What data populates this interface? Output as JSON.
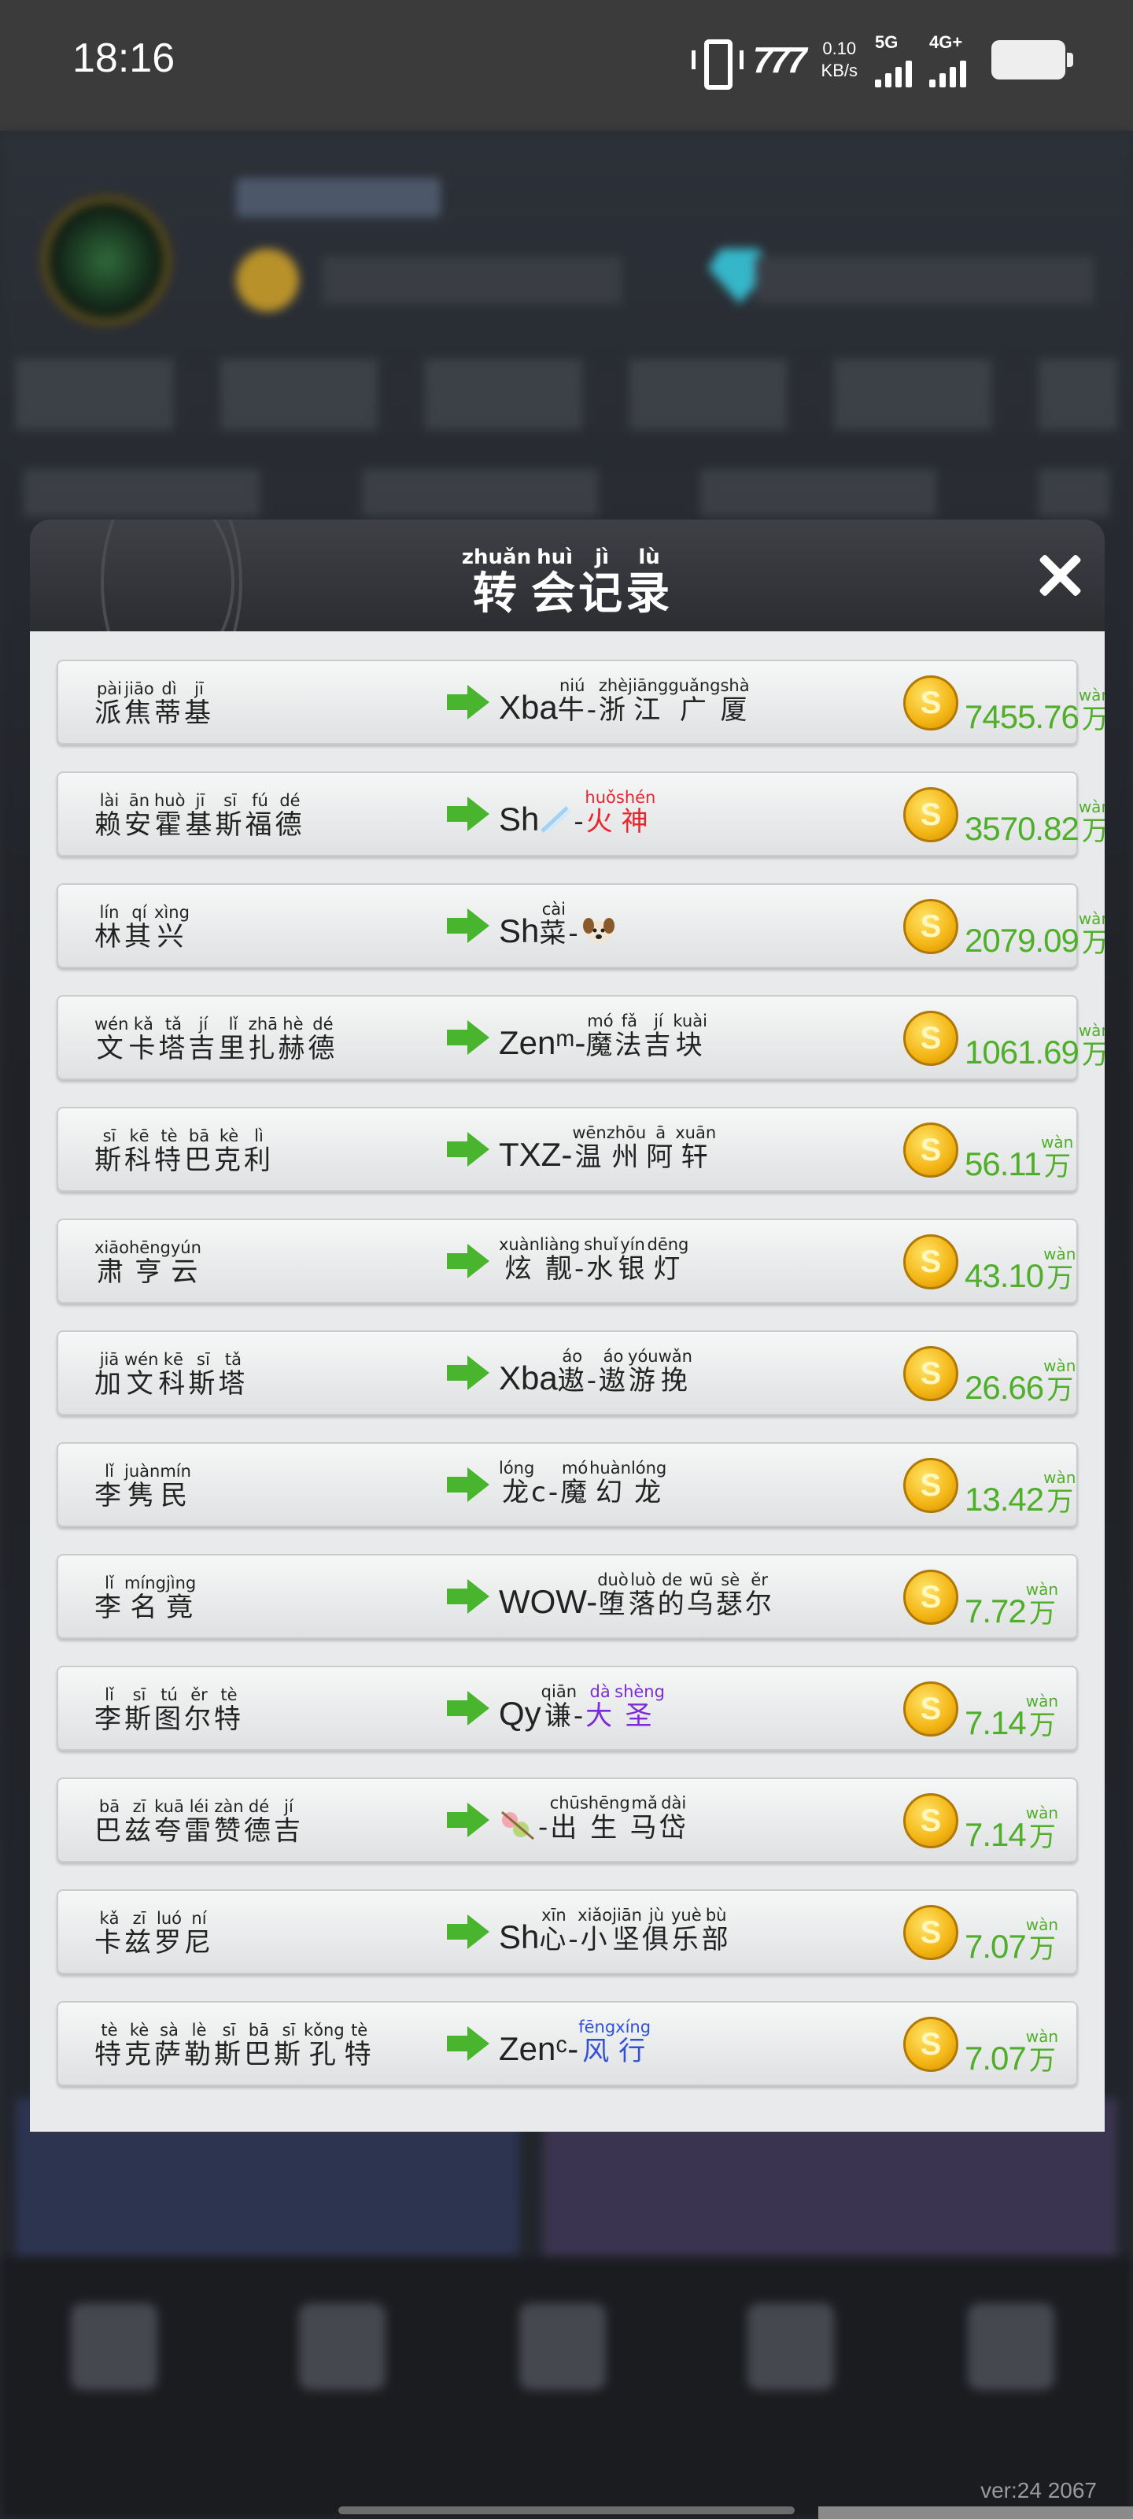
{
  "status_bar": {
    "time": "18:16",
    "logo": "777",
    "speed_value": "0.10",
    "speed_unit": "KB/s",
    "net1": "5G",
    "net2": "4G+"
  },
  "modal": {
    "title_chars": [
      {
        "ch": "转",
        "py": "zhuǎn"
      },
      {
        "ch": "会",
        "py": "huì"
      },
      {
        "ch": "记",
        "py": "jì"
      },
      {
        "ch": "录",
        "py": "lù"
      }
    ]
  },
  "transfers": [
    {
      "from": [
        [
          "派",
          "pài"
        ],
        [
          "焦",
          "jiāo"
        ],
        [
          "蒂",
          "dì"
        ],
        [
          "基",
          "jī"
        ]
      ],
      "to_prefix": "Xba",
      "to_parts": [
        [
          "牛",
          "niú"
        ],
        [
          "-",
          ""
        ],
        [
          "浙",
          "zhè"
        ],
        [
          "江",
          "jiāng"
        ],
        [
          "广",
          "guǎng"
        ],
        [
          "厦",
          "shà"
        ]
      ],
      "amount": "7455.76",
      "unit": [
        "万",
        "wàn"
      ]
    },
    {
      "from": [
        [
          "赖",
          "lài"
        ],
        [
          "安",
          "ān"
        ],
        [
          "霍",
          "huò"
        ],
        [
          "基",
          "jī"
        ],
        [
          "斯",
          "sī"
        ],
        [
          "福",
          "fú"
        ],
        [
          "德",
          "dé"
        ]
      ],
      "to_prefix": "Sh",
      "to_parts": [
        [
          "-",
          ""
        ],
        [
          "火",
          "huǒ"
        ],
        [
          "神",
          "shén"
        ]
      ],
      "amount": "3570.82",
      "unit": [
        "万",
        "wàn"
      ]
    },
    {
      "from": [
        [
          "林",
          "lín"
        ],
        [
          "其",
          "qí"
        ],
        [
          "兴",
          "xìng"
        ]
      ],
      "to_prefix": "Sh",
      "to_parts": [
        [
          "菜",
          "cài"
        ],
        [
          "-",
          ""
        ]
      ],
      "amount": "2079.09",
      "unit": [
        "万",
        "wàn"
      ]
    },
    {
      "from": [
        [
          "文",
          "wén"
        ],
        [
          "卡",
          "kǎ"
        ],
        [
          "塔",
          "tǎ"
        ],
        [
          "吉",
          "jí"
        ],
        [
          "里",
          "lǐ"
        ],
        [
          "扎",
          "zhā"
        ],
        [
          "赫",
          "hè"
        ],
        [
          "德",
          "dé"
        ]
      ],
      "to_prefix": "Zenᵐ-",
      "to_parts": [
        [
          "魔",
          "mó"
        ],
        [
          "法",
          "fǎ"
        ],
        [
          "吉",
          "jí"
        ],
        [
          "块",
          "kuài"
        ]
      ],
      "amount": "1061.69",
      "unit": [
        "万",
        "wàn"
      ]
    },
    {
      "from": [
        [
          "斯",
          "sī"
        ],
        [
          "科",
          "kē"
        ],
        [
          "特",
          "tè"
        ],
        [
          "巴",
          "bā"
        ],
        [
          "克",
          "kè"
        ],
        [
          "利",
          "lì"
        ]
      ],
      "to_prefix": "TXZ-",
      "to_parts": [
        [
          "温",
          "wēn"
        ],
        [
          "州",
          "zhōu"
        ],
        [
          "阿",
          "ā"
        ],
        [
          "轩",
          "xuān"
        ]
      ],
      "amount": "56.11",
      "unit": [
        "万",
        "wàn"
      ]
    },
    {
      "from": [
        [
          "肃",
          "xiāo"
        ],
        [
          "亨",
          "hēng"
        ],
        [
          "云",
          "yún"
        ]
      ],
      "to_prefix": "",
      "to_parts": [
        [
          "炫",
          "xuàn"
        ],
        [
          "靓",
          "liàng"
        ],
        [
          "-",
          ""
        ],
        [
          "水",
          "shuǐ"
        ],
        [
          "银",
          "yín"
        ],
        [
          "灯",
          "dēng"
        ]
      ],
      "amount": "43.10",
      "unit": [
        "万",
        "wàn"
      ]
    },
    {
      "from": [
        [
          "加",
          "jiā"
        ],
        [
          "文",
          "wén"
        ],
        [
          "科",
          "kē"
        ],
        [
          "斯",
          "sī"
        ],
        [
          "塔",
          "tǎ"
        ]
      ],
      "to_prefix": "Xba",
      "to_parts": [
        [
          "遨",
          "áo"
        ],
        [
          "-",
          ""
        ],
        [
          "遨",
          "áo"
        ],
        [
          "游",
          "yóu"
        ],
        [
          "挽",
          "wǎn"
        ]
      ],
      "amount": "26.66",
      "unit": [
        "万",
        "wàn"
      ]
    },
    {
      "from": [
        [
          "李",
          "lǐ"
        ],
        [
          "隽",
          "juàn"
        ],
        [
          "民",
          "mín"
        ]
      ],
      "to_prefix": "",
      "to_parts": [
        [
          "龙",
          "lóng"
        ],
        [
          "c-",
          ""
        ],
        [
          "魔",
          "mó"
        ],
        [
          "幻",
          "huàn"
        ],
        [
          "龙",
          "lóng"
        ]
      ],
      "amount": "13.42",
      "unit": [
        "万",
        "wàn"
      ]
    },
    {
      "from": [
        [
          "李",
          "lǐ"
        ],
        [
          "名",
          "míng"
        ],
        [
          "竟",
          "jìng"
        ]
      ],
      "to_prefix": "WOW-",
      "to_parts": [
        [
          "堕",
          "duò"
        ],
        [
          "落",
          "luò"
        ],
        [
          "的",
          "de"
        ],
        [
          "乌",
          "wū"
        ],
        [
          "瑟",
          "sè"
        ],
        [
          "尔",
          "ěr"
        ]
      ],
      "amount": "7.72",
      "unit": [
        "万",
        "wàn"
      ]
    },
    {
      "from": [
        [
          "李",
          "lǐ"
        ],
        [
          "斯",
          "sī"
        ],
        [
          "图",
          "tú"
        ],
        [
          "尔",
          "ěr"
        ],
        [
          "特",
          "tè"
        ]
      ],
      "to_prefix": "Qy",
      "to_parts": [
        [
          "谦",
          "qiān"
        ],
        [
          "-",
          ""
        ],
        [
          "大",
          "dà"
        ],
        [
          "圣",
          "shèng"
        ]
      ],
      "amount": "7.14",
      "unit": [
        "万",
        "wàn"
      ]
    },
    {
      "from": [
        [
          "巴",
          "bā"
        ],
        [
          "兹",
          "zī"
        ],
        [
          "夸",
          "kuā"
        ],
        [
          "雷",
          "léi"
        ],
        [
          "赞",
          "zàn"
        ],
        [
          "德",
          "dé"
        ],
        [
          "吉",
          "jí"
        ]
      ],
      "to_prefix": "",
      "to_parts": [
        [
          "-",
          ""
        ],
        [
          "出",
          "chū"
        ],
        [
          "生",
          "shēng"
        ],
        [
          "马",
          "mǎ"
        ],
        [
          "岱",
          "dài"
        ]
      ],
      "amount": "7.14",
      "unit": [
        "万",
        "wàn"
      ]
    },
    {
      "from": [
        [
          "卡",
          "kǎ"
        ],
        [
          "兹",
          "zī"
        ],
        [
          "罗",
          "luó"
        ],
        [
          "尼",
          "ní"
        ]
      ],
      "to_prefix": "Sh",
      "to_parts": [
        [
          "心",
          "xīn"
        ],
        [
          "-",
          ""
        ],
        [
          "小",
          "xiǎo"
        ],
        [
          "坚",
          "jiān"
        ],
        [
          "俱",
          "jù"
        ],
        [
          "乐",
          "yuè"
        ],
        [
          "部",
          "bù"
        ]
      ],
      "amount": "7.07",
      "unit": [
        "万",
        "wàn"
      ]
    },
    {
      "from": [
        [
          "特",
          "tè"
        ],
        [
          "克",
          "kè"
        ],
        [
          "萨",
          "sà"
        ],
        [
          "勒",
          "lè"
        ],
        [
          "斯",
          "sī"
        ],
        [
          "巴",
          "bā"
        ],
        [
          "斯",
          "sī"
        ],
        [
          "孔",
          "kǒng"
        ],
        [
          "特",
          "tè"
        ]
      ],
      "to_prefix": "Zenᶜ-",
      "to_parts": [
        [
          "风",
          "fēng"
        ],
        [
          "行",
          "xíng"
        ]
      ],
      "amount": "7.07",
      "unit": [
        "万",
        "wàn"
      ]
    }
  ],
  "version": "ver:24   2067",
  "colors": {
    "amount_green": "#4fae2a",
    "arrow_green": "#49b42d",
    "highlight_red": "#e8262d",
    "highlight_purple": "#7b2bd8",
    "highlight_blue": "#3050d8"
  }
}
